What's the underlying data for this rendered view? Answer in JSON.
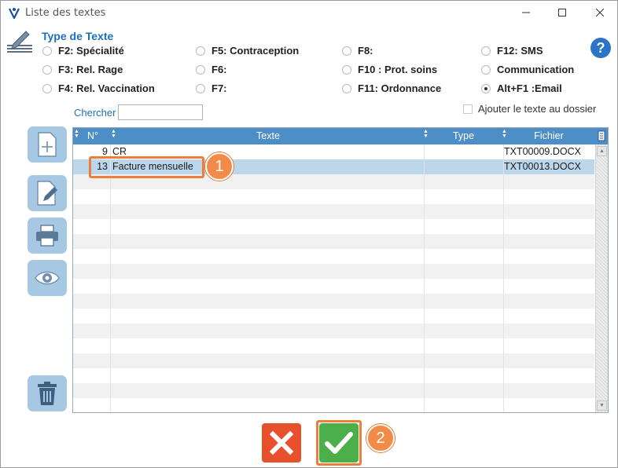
{
  "window": {
    "title": "Liste des  textes",
    "icons": {
      "app": "caduceus-icon",
      "minimize": "minimize-icon",
      "maximize": "maximize-icon",
      "close": "close-icon"
    }
  },
  "type_section": {
    "title": "Type de Texte",
    "help_label": "?",
    "options": [
      {
        "label": "F2: Spécialité",
        "checked": false
      },
      {
        "label": "F5: Contraception",
        "checked": false
      },
      {
        "label": "F8:",
        "checked": false
      },
      {
        "label": "F12: SMS",
        "checked": false
      },
      {
        "label": "F3: Rel. Rage",
        "checked": false
      },
      {
        "label": "F6:",
        "checked": false
      },
      {
        "label": "F10 : Prot. soins",
        "checked": false
      },
      {
        "label": "Communication",
        "checked": false
      },
      {
        "label": "F4: Rel. Vaccination",
        "checked": false
      },
      {
        "label": "F7:",
        "checked": false
      },
      {
        "label": "F11: Ordonnance",
        "checked": false
      },
      {
        "label": "Alt+F1 :Email",
        "checked": true
      }
    ]
  },
  "search": {
    "label": "Chercher",
    "value": "",
    "placeholder": ""
  },
  "add_to_folder": {
    "label": "Ajouter le texte au dossier",
    "checked": false
  },
  "side_buttons": [
    "new-document-icon",
    "edit-document-icon",
    "printer-icon",
    "eye-icon",
    "trash-icon"
  ],
  "table": {
    "columns": [
      "N°",
      "Texte",
      "Type",
      "Fichier"
    ],
    "rows": [
      {
        "num": "9",
        "texte": "CR",
        "type": "",
        "fichier": "TXT00009.DOCX",
        "selected": false
      },
      {
        "num": "13",
        "texte": "Facture mensuelle",
        "type": "",
        "fichier": "TXT00013.DOCX",
        "selected": true
      }
    ]
  },
  "annotations": {
    "badge1": "1",
    "badge2": "2"
  },
  "actions": {
    "cancel": "cancel-x-icon",
    "confirm": "check-icon"
  },
  "colors": {
    "accent": "#1d6fc0",
    "header": "#4d8ec6",
    "selected_row": "#bcd6ec",
    "highlight": "#ee7d3a",
    "cancel": "#e8502c",
    "confirm": "#4cb04a"
  }
}
